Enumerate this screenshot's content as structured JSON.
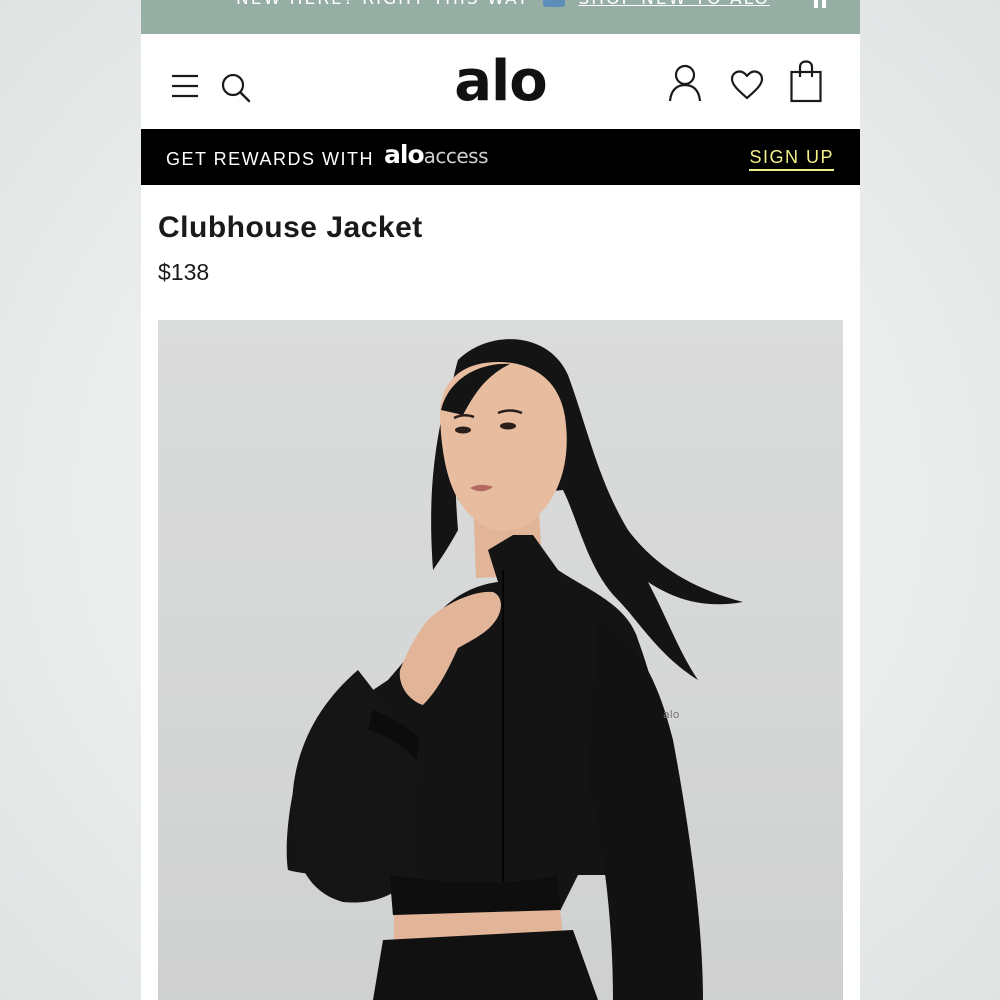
{
  "promo": {
    "text": "NEW HERE? RIGHT THIS WAY",
    "link": "SHOP NEW TO ALO"
  },
  "header": {
    "logo": "alo",
    "icons": [
      "menu-icon",
      "search-icon",
      "account-icon",
      "wishlist-icon",
      "bag-icon"
    ]
  },
  "rewards": {
    "text": "GET REWARDS WITH",
    "logo_alo": "alo",
    "logo_access": "access",
    "signup_label": "SIGN UP"
  },
  "product": {
    "title": "Clubhouse Jacket",
    "price": "$138",
    "sleeve_logo": "alo"
  },
  "colors": {
    "promo_bg": "#96aea3",
    "rewards_bg": "#000000",
    "signup": "#f3ef8a",
    "image_bg": "#d6d7d7",
    "garment": "#141414"
  }
}
